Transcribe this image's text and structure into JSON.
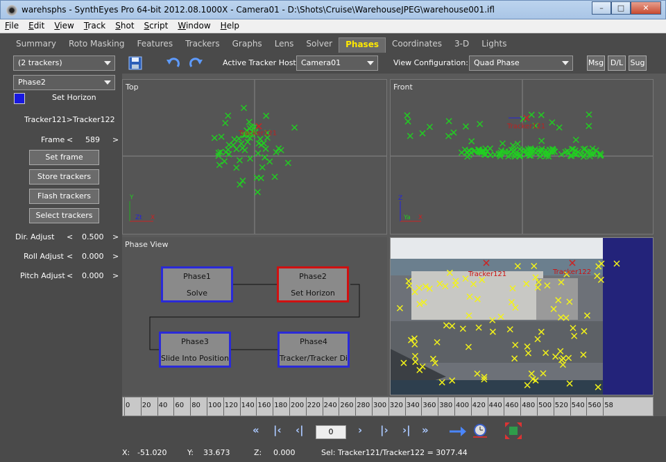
{
  "window": {
    "title": "warehsphs - SynthEyes Pro 64-bit 2012.08.1000X - Camera01 - D:\\Shots\\Cruise\\WarehouseJPEG\\warehouse001.ifl"
  },
  "menu": [
    "File",
    "Edit",
    "View",
    "Track",
    "Shot",
    "Script",
    "Window",
    "Help"
  ],
  "tabs": [
    "Summary",
    "Roto Masking",
    "Features",
    "Trackers",
    "Graphs",
    "Lens",
    "Solver",
    "Phases",
    "Coordinates",
    "3-D",
    "Lights"
  ],
  "active_tab": "Phases",
  "toolbar": {
    "tracker_select": "(2 trackers)",
    "phase_select": "Phase2",
    "active_host_label": "Active Tracker Host:",
    "active_host_value": "Camera01",
    "view_config_label": "View Configuration:",
    "view_config_value": "Quad Phase",
    "msg_btn": "Msg",
    "dl_btn": "D/L",
    "sug_btn": "Sug"
  },
  "left": {
    "set_horizon_label": "Set Horizon",
    "tracker_pair": "Tracker121>Tracker122",
    "frame_label": "Frame",
    "frame_value": "589",
    "set_frame": "Set frame",
    "store_trackers": "Store trackers",
    "flash_trackers": "Flash trackers",
    "select_trackers": "Select trackers",
    "dir_adjust_label": "Dir. Adjust",
    "dir_adjust_value": "0.500",
    "roll_adjust_label": "Roll Adjust",
    "roll_adjust_value": "0.000",
    "pitch_adjust_label": "Pitch Adjust",
    "pitch_adjust_value": "0.000",
    "lt": "<",
    "gt": ">"
  },
  "views": {
    "top_title": "Top",
    "front_title": "Front",
    "phase_title": "Phase View",
    "tracker121": "Tracker121",
    "tracker122": "Tracker122",
    "axis_y": "Y",
    "axis_zt": "Zt",
    "axis_x": "X",
    "axis_z": "Z",
    "axis_ya": "Ya"
  },
  "phases": [
    {
      "name": "Phase1",
      "type": "Solve",
      "selected": false
    },
    {
      "name": "Phase2",
      "type": "Set Horizon",
      "selected": true
    },
    {
      "name": "Phase3",
      "type": "Slide Into Position",
      "selected": false
    },
    {
      "name": "Phase4",
      "type": "Tracker/Tracker Distance",
      "selected": false
    }
  ],
  "timeline": {
    "ticks": [
      "0",
      "20",
      "40",
      "60",
      "80",
      "100",
      "120",
      "140",
      "160",
      "180",
      "200",
      "220",
      "240",
      "260",
      "280",
      "300",
      "320",
      "340",
      "360",
      "380",
      "400",
      "420",
      "440",
      "460",
      "480",
      "500",
      "520",
      "540",
      "560",
      "58"
    ]
  },
  "playback": {
    "frame_box": "0"
  },
  "status": {
    "x_label": "X:",
    "x_value": "-51.020",
    "y_label": "Y:",
    "y_value": "33.673",
    "z_label": "Z:",
    "z_value": "0.000",
    "sel": "Sel: Tracker121/Tracker122 = 3077.44"
  },
  "colors": {
    "tracker": "#22cc22",
    "selected_tracker": "#cc2222",
    "phase_border": "#2a2ad8",
    "phase_selected": "#d01010",
    "active_tab": "#ffe900"
  }
}
